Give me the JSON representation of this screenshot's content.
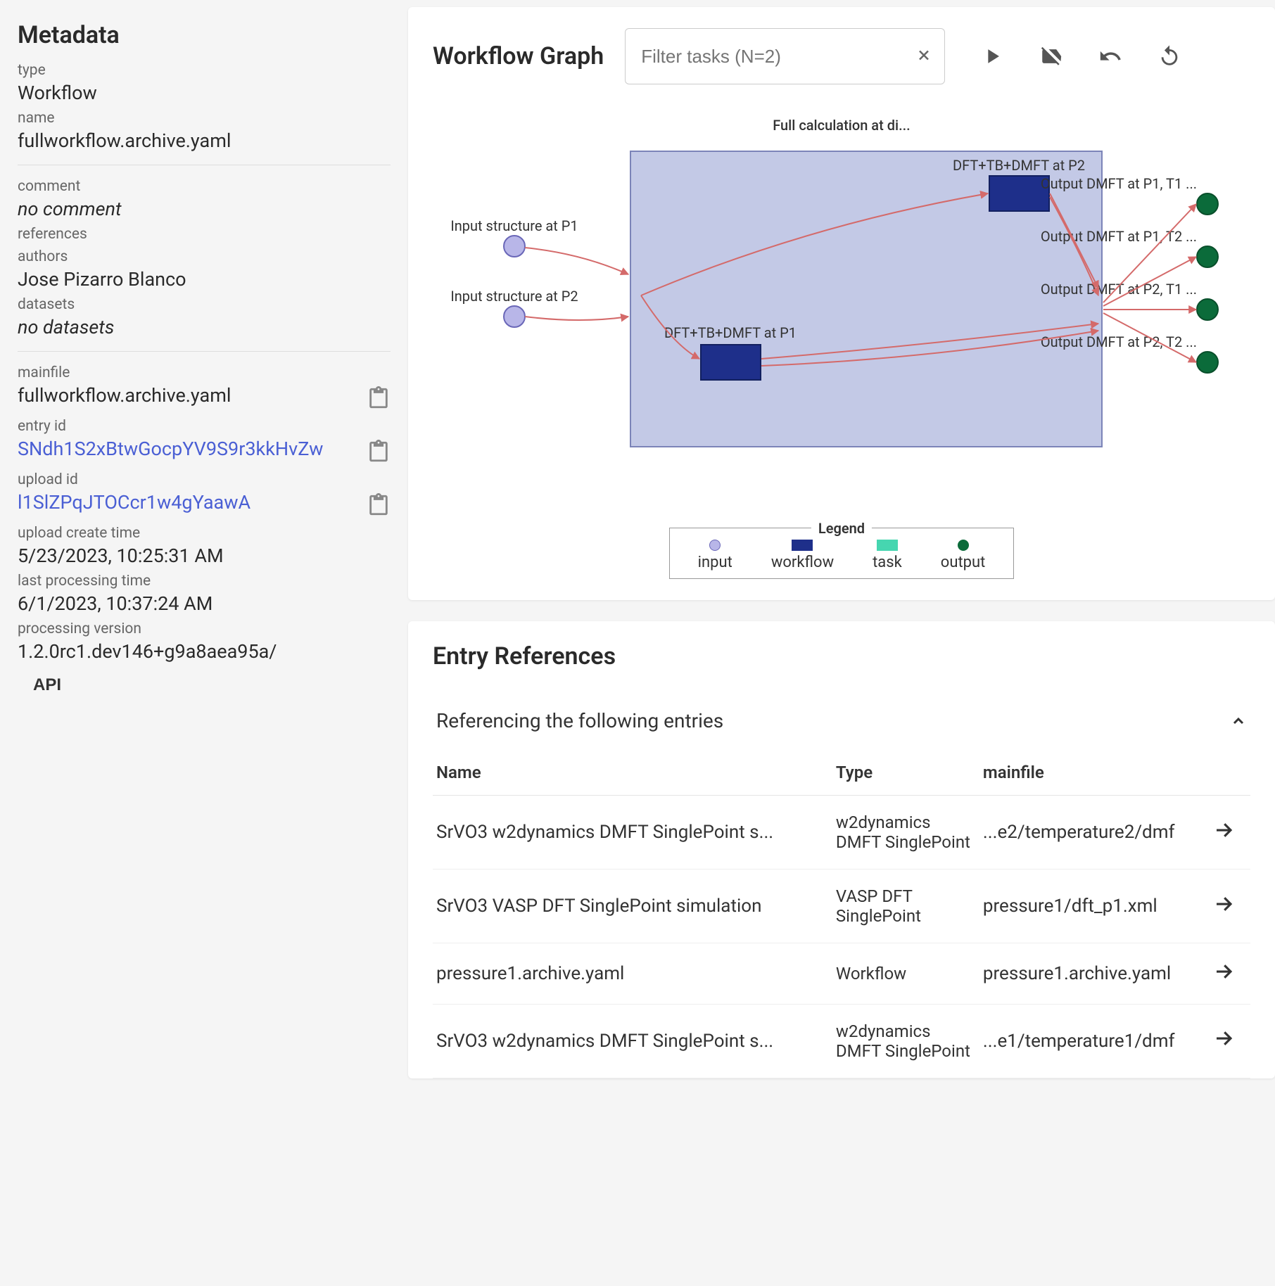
{
  "sidebar": {
    "title": "Metadata",
    "type_label": "type",
    "type_value": "Workflow",
    "name_label": "name",
    "name_value": "fullworkflow.archive.yaml",
    "comment_label": "comment",
    "comment_value": "no comment",
    "references_label": "references",
    "authors_label": "authors",
    "authors_value": "Jose Pizarro Blanco",
    "datasets_label": "datasets",
    "datasets_value": "no datasets",
    "mainfile_label": "mainfile",
    "mainfile_value": "fullworkflow.archive.yaml",
    "entry_id_label": "entry id",
    "entry_id_value": "SNdh1S2xBtwGocpYV9S9r3kkHvZw",
    "upload_id_label": "upload id",
    "upload_id_value": "l1SlZPqJTOCcr1w4gYaawA",
    "upload_create_label": "upload create time",
    "upload_create_value": "5/23/2023, 10:25:31 AM",
    "last_proc_label": "last processing time",
    "last_proc_value": "6/1/2023, 10:37:24 AM",
    "proc_version_label": "processing version",
    "proc_version_value": "1.2.0rc1.dev146+g9a8aea95a/",
    "api_button": "API"
  },
  "graph": {
    "title": "Workflow Graph",
    "filter_placeholder": "Filter tasks (N=2)",
    "caption": "Full calculation at di...",
    "inputs": [
      "Input structure at P1",
      "Input structure at P2"
    ],
    "tasks": [
      "DFT+TB+DMFT at P1",
      "DFT+TB+DMFT at P2"
    ],
    "outputs": [
      "Output DMFT at P1, T1 ...",
      "Output DMFT at P1, T2 ...",
      "Output DMFT at P2, T1 ...",
      "Output DMFT at P2, T2 ..."
    ],
    "legend": {
      "title": "Legend",
      "input": "input",
      "workflow": "workflow",
      "task": "task",
      "output": "output"
    }
  },
  "refs": {
    "title": "Entry References",
    "section_label": "Referencing the following entries",
    "columns": {
      "name": "Name",
      "type": "Type",
      "mainfile": "mainfile"
    },
    "rows": [
      {
        "name": "SrVO3 w2dynamics DMFT SinglePoint s...",
        "type": "w2dynamics DMFT SinglePoint",
        "mainfile": "...e2/temperature2/dmf"
      },
      {
        "name": "SrVO3 VASP DFT SinglePoint simulation",
        "type": "VASP DFT SinglePoint",
        "mainfile": "pressure1/dft_p1.xml"
      },
      {
        "name": "pressure1.archive.yaml",
        "type": "Workflow",
        "mainfile": "pressure1.archive.yaml"
      },
      {
        "name": "SrVO3 w2dynamics DMFT SinglePoint s...",
        "type": "w2dynamics DMFT SinglePoint",
        "mainfile": "...e1/temperature1/dmf"
      }
    ]
  }
}
